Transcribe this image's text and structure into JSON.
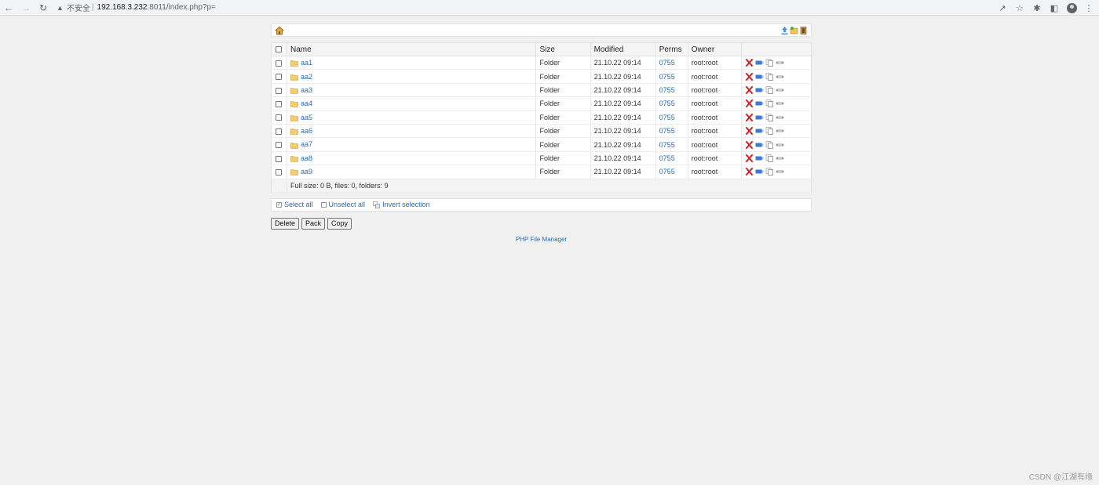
{
  "browser": {
    "security_label": "不安全",
    "host": "192.168.3.232",
    "path": ":8011/index.php?p="
  },
  "table": {
    "headers": {
      "name": "Name",
      "size": "Size",
      "modified": "Modified",
      "perms": "Perms",
      "owner": "Owner"
    },
    "rows": [
      {
        "name": "aa1",
        "size": "Folder",
        "modified": "21.10.22 09:14",
        "perms": "0755",
        "owner": "root:root"
      },
      {
        "name": "aa2",
        "size": "Folder",
        "modified": "21.10.22 09:14",
        "perms": "0755",
        "owner": "root:root"
      },
      {
        "name": "aa3",
        "size": "Folder",
        "modified": "21.10.22 09:14",
        "perms": "0755",
        "owner": "root:root"
      },
      {
        "name": "aa4",
        "size": "Folder",
        "modified": "21.10.22 09:14",
        "perms": "0755",
        "owner": "root:root"
      },
      {
        "name": "aa5",
        "size": "Folder",
        "modified": "21.10.22 09:14",
        "perms": "0755",
        "owner": "root:root"
      },
      {
        "name": "aa6",
        "size": "Folder",
        "modified": "21.10.22 09:14",
        "perms": "0755",
        "owner": "root:root"
      },
      {
        "name": "aa7",
        "size": "Folder",
        "modified": "21.10.22 09:14",
        "perms": "0755",
        "owner": "root:root"
      },
      {
        "name": "aa8",
        "size": "Folder",
        "modified": "21.10.22 09:14",
        "perms": "0755",
        "owner": "root:root"
      },
      {
        "name": "aa9",
        "size": "Folder",
        "modified": "21.10.22 09:14",
        "perms": "0755",
        "owner": "root:root"
      }
    ],
    "footer": "Full size: 0 B, files: 0, folders: 9"
  },
  "selection": {
    "select_all": "Select all",
    "unselect_all": "Unselect all",
    "invert": "Invert selection"
  },
  "buttons": {
    "delete": "Delete",
    "pack": "Pack",
    "copy": "Copy"
  },
  "footer_link": "PHP File Manager",
  "watermark": "CSDN @江湖有缘",
  "colors": {
    "link": "#2a6cb0",
    "background": "#f0f0f0",
    "delete_red": "#d21f1f"
  }
}
